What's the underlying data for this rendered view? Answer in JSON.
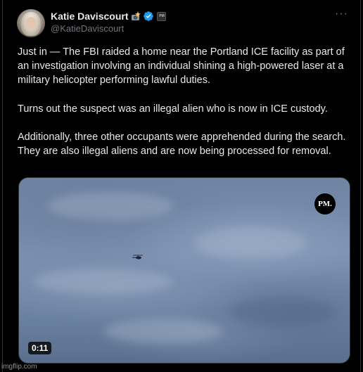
{
  "author": {
    "display_name": "Katie Daviscourt",
    "handle": "@KatieDaviscourt",
    "emoji_icon": "camera-flash-emoji",
    "verified_color": "#1d9bf0",
    "affiliation_badge": "PM"
  },
  "menu": {
    "more_label": "···"
  },
  "post": {
    "paragraphs": [
      "Just in — The FBI raided a home near the Portland ICE facility as part of an investigation involving an individual shining a high-powered laser at a military helicopter performing lawful duties.",
      "Turns out the suspect was an illegal alien who is now in ICE custody.",
      "Additionally, three other occupants were apprehended during the search. They are also illegal aliens and are now being processed for removal."
    ]
  },
  "media": {
    "type": "video",
    "duration": "0:11",
    "logo_text": "PM."
  },
  "watermark": "imgflip.com"
}
